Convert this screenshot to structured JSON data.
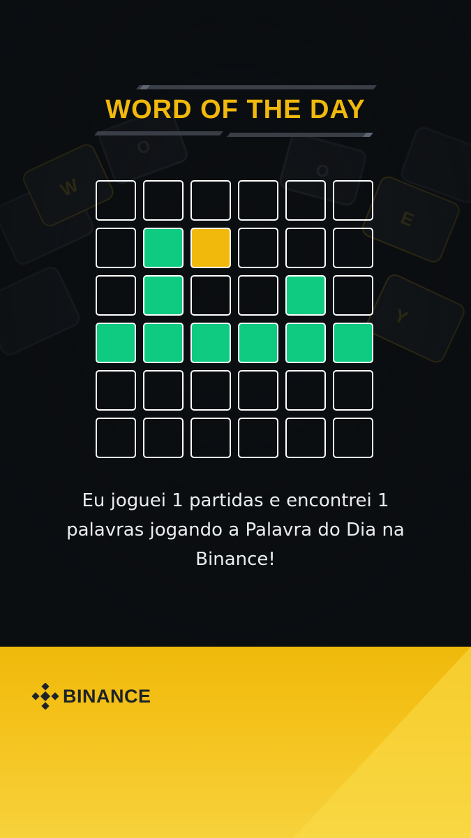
{
  "title": "WORD OF THE DAY",
  "board": {
    "rows": [
      [
        "empty",
        "empty",
        "empty",
        "empty",
        "empty",
        "empty"
      ],
      [
        "empty",
        "green",
        "yellow",
        "empty",
        "empty",
        "empty"
      ],
      [
        "empty",
        "green",
        "empty",
        "empty",
        "green",
        "empty"
      ],
      [
        "green",
        "green",
        "green",
        "green",
        "green",
        "green"
      ],
      [
        "empty",
        "empty",
        "empty",
        "empty",
        "empty",
        "empty"
      ],
      [
        "empty",
        "empty",
        "empty",
        "empty",
        "empty",
        "empty"
      ]
    ]
  },
  "message": "Eu joguei 1 partidas e encontrei 1 palavras jogando a Palavra do Dia na Binance!",
  "brand": {
    "name": "BINANCE"
  },
  "colors": {
    "background": "#0b0e11",
    "accent": "#f0b90b",
    "correct": "#0ecb81",
    "present": "#f0b90b",
    "tile_border": "#ffffff"
  }
}
